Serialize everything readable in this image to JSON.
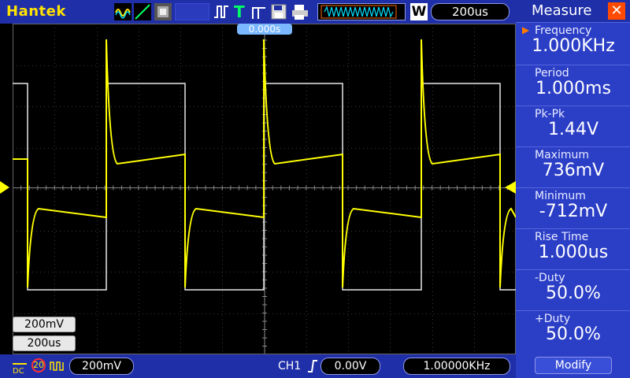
{
  "brand": "Hantek",
  "timebase": "200us",
  "trigger_position": "0.000s",
  "scale": {
    "volts": "200mV",
    "time": "200us"
  },
  "bottom": {
    "ch_volts": "200mV",
    "probe": "20",
    "trigger_channel": "CH1",
    "trigger_level": "0.00V",
    "frequency_counter": "1.00000KHz"
  },
  "measure": {
    "title": "Measure",
    "items": [
      {
        "label": "Frequency",
        "value": "1.000KHz"
      },
      {
        "label": "Period",
        "value": "1.000ms"
      },
      {
        "label": "Pk-Pk",
        "value": "1.44V"
      },
      {
        "label": "Maximum",
        "value": "736mV"
      },
      {
        "label": "Minimum",
        "value": "-712mV"
      },
      {
        "label": "Rise Time",
        "value": "1.000us"
      },
      {
        "label": "-Duty",
        "value": "50.0%"
      },
      {
        "label": "+Duty",
        "value": "50.0%"
      }
    ],
    "modify": "Modify"
  },
  "colors": {
    "ch1": "#ffff00",
    "ref": "#e8e8e8",
    "panel": "#2b3ec6",
    "bar": "#1f2fa8"
  },
  "icons": [
    "waveform-icon",
    "line-mode-icon",
    "persist-icon",
    "trigger-edge-icon",
    "trigger-t-icon",
    "save-icon",
    "print-icon",
    "run-mode-icon",
    "memory-icon"
  ]
}
